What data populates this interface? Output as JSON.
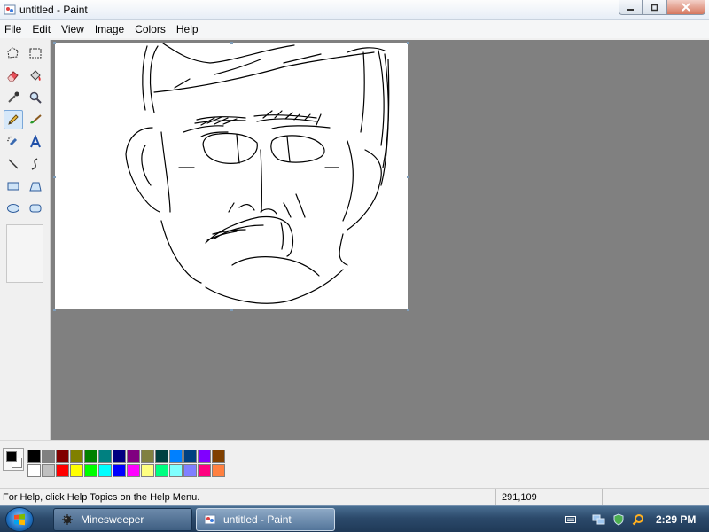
{
  "window": {
    "title": "untitled - Paint"
  },
  "menu": [
    "File",
    "Edit",
    "View",
    "Image",
    "Colors",
    "Help"
  ],
  "tools": [
    "free-form-select",
    "rectangle-select",
    "eraser",
    "fill-with-color",
    "pick-color",
    "magnifier",
    "pencil",
    "brush",
    "airbrush",
    "text",
    "line",
    "curve",
    "rectangle",
    "polygon",
    "ellipse",
    "rounded-rectangle"
  ],
  "selected_tool": "pencil",
  "colors": {
    "foreground": "#000000",
    "background": "#ffffff",
    "palette": [
      "#000000",
      "#808080",
      "#800000",
      "#808000",
      "#008000",
      "#008080",
      "#000080",
      "#800080",
      "#808040",
      "#004040",
      "#0080ff",
      "#004080",
      "#8000ff",
      "#804000",
      "#ffffff",
      "#c0c0c0",
      "#ff0000",
      "#ffff00",
      "#00ff00",
      "#00ffff",
      "#0000ff",
      "#ff00ff",
      "#ffff80",
      "#00ff80",
      "#80ffff",
      "#8080ff",
      "#ff0080",
      "#ff8040"
    ]
  },
  "status": {
    "help": "For Help, click Help Topics on the Help Menu.",
    "coords": "291,109"
  },
  "taskbar": {
    "buttons": [
      {
        "label": "Minesweeper",
        "active": false
      },
      {
        "label": "untitled - Paint",
        "active": true
      }
    ],
    "clock": "2:29 PM"
  }
}
